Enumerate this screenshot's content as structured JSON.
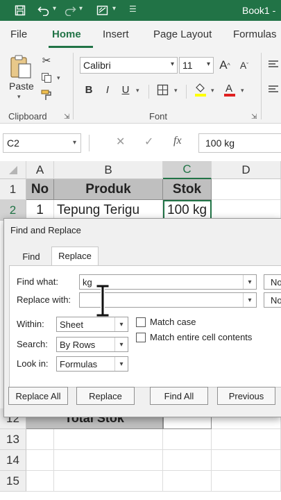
{
  "app": {
    "title": "Book1 -"
  },
  "ribbon": {
    "tabs": [
      "File",
      "Home",
      "Insert",
      "Page Layout",
      "Formulas"
    ],
    "active_tab": "Home",
    "clipboard": {
      "group_label": "Clipboard",
      "paste_label": "Paste"
    },
    "font": {
      "group_label": "Font",
      "family": "Calibri",
      "size": "11",
      "bold": "B",
      "italic": "I",
      "underline": "U"
    }
  },
  "formula_bar": {
    "name_box": "C2",
    "fx": "fx",
    "value": "100 kg"
  },
  "grid": {
    "columns": [
      "A",
      "B",
      "C",
      "D"
    ],
    "selected_column": "C",
    "rows_top": [
      "1",
      "2"
    ],
    "rows_bottom": [
      "12",
      "13",
      "14",
      "15"
    ],
    "header_row": {
      "no": "No",
      "produk": "Produk",
      "stok": "Stok"
    },
    "row2": {
      "no": "1",
      "produk": "Tepung Terigu",
      "stok": "100 kg"
    },
    "total_label": "Total Stok"
  },
  "dialog": {
    "title": "Find and Replace",
    "tabs": {
      "find": "Find",
      "replace": "Replace"
    },
    "active_tab": "Replace",
    "find_what_label": "Find what:",
    "find_what_value": "kg",
    "replace_with_label": "Replace with:",
    "replace_with_value": "",
    "format_btn_1": "No",
    "format_btn_2": "No",
    "within_label": "Within:",
    "within_value": "Sheet",
    "search_label": "Search:",
    "search_value": "By Rows",
    "look_in_label": "Look in:",
    "look_in_value": "Formulas",
    "match_case_label": "Match case",
    "match_entire_label": "Match entire cell contents",
    "buttons": {
      "replace_all": "Replace All",
      "replace": "Replace",
      "find_all": "Find All",
      "previous": "Previous"
    }
  },
  "colors": {
    "excel_green": "#217346",
    "header_fill": "#bfbfbf"
  }
}
